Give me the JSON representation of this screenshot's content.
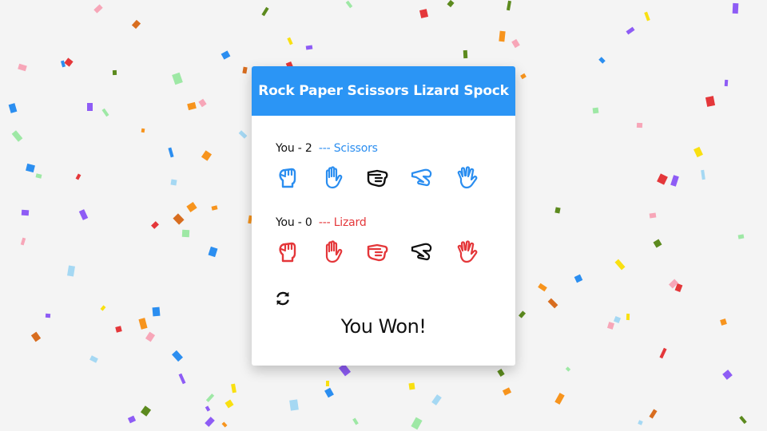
{
  "app": {
    "title": "Rock Paper Scissors Lizard Spock"
  },
  "colors": {
    "header": "#2b95f5",
    "player": "#2b8ef0",
    "computer": "#e4373a",
    "selected": "#111111",
    "background": "#f4f4f4"
  },
  "player": {
    "name_label": "You",
    "score": "2",
    "choice_text": "--- Scissors",
    "selected": "scissors"
  },
  "computer": {
    "name_label": "You",
    "score": "0",
    "choice_text": "--- Lizard",
    "selected": "lizard"
  },
  "hands": [
    {
      "id": "rock",
      "icon": "hand-rock-icon"
    },
    {
      "id": "paper",
      "icon": "hand-paper-icon"
    },
    {
      "id": "scissors",
      "icon": "hand-scissors-icon"
    },
    {
      "id": "lizard",
      "icon": "hand-lizard-icon"
    },
    {
      "id": "spock",
      "icon": "hand-spock-icon"
    }
  ],
  "reset": {
    "icon": "sync-icon"
  },
  "result": {
    "text": "You Won!"
  },
  "confetti_colors": [
    "#f7941d",
    "#2b8ef0",
    "#5c8a1e",
    "#e4373a",
    "#8e5cf5",
    "#f9e011",
    "#9ee8a5",
    "#f7a6b8",
    "#a5d8f3",
    "#d86d1f"
  ]
}
